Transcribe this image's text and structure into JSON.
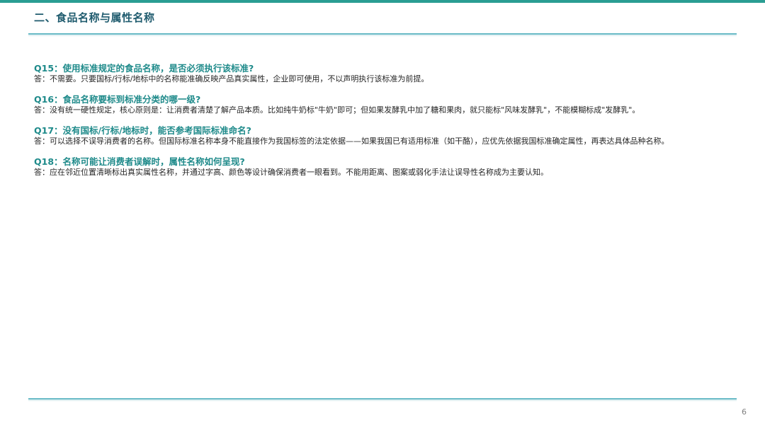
{
  "slide": {
    "section_title": "二、食品名称与属性名称",
    "page_number": "6",
    "colors": {
      "accent": "#2a9d93",
      "question": "#1e8a8a",
      "title": "#1f5b6e",
      "rule": "#62b7c4"
    }
  },
  "qa": [
    {
      "question": "Q15：使用标准规定的食品名称，是否必须执行该标准?",
      "answer": "答：不需要。只要国标/行标/地标中的名称能准确反映产品真实属性，企业即可使用，不以声明执行该标准为前提。"
    },
    {
      "question": "Q16：食品名称要标到标准分类的哪一级?",
      "answer": "答：没有统一硬性规定，核心原则是：让消费者清楚了解产品本质。比如纯牛奶标\"牛奶\"即可；但如果发酵乳中加了糖和果肉，就只能标\"风味发酵乳\"，不能模糊标成\"发酵乳\"。"
    },
    {
      "question": "Q17：没有国标/行标/地标时，能否参考国际标准命名?",
      "answer": "答：可以选择不误导消费者的名称。但国际标准名称本身不能直接作为我国标签的法定依据——如果我国已有适用标准（如干酪），应优先依据我国标准确定属性，再表达具体品种名称。"
    },
    {
      "question": "Q18：名称可能让消费者误解时，属性名称如何呈现?",
      "answer": "答：应在邻近位置清晰标出真实属性名称，并通过字高、颜色等设计确保消费者一眼看到。不能用距离、图案或弱化手法让误导性名称成为主要认知。"
    }
  ]
}
